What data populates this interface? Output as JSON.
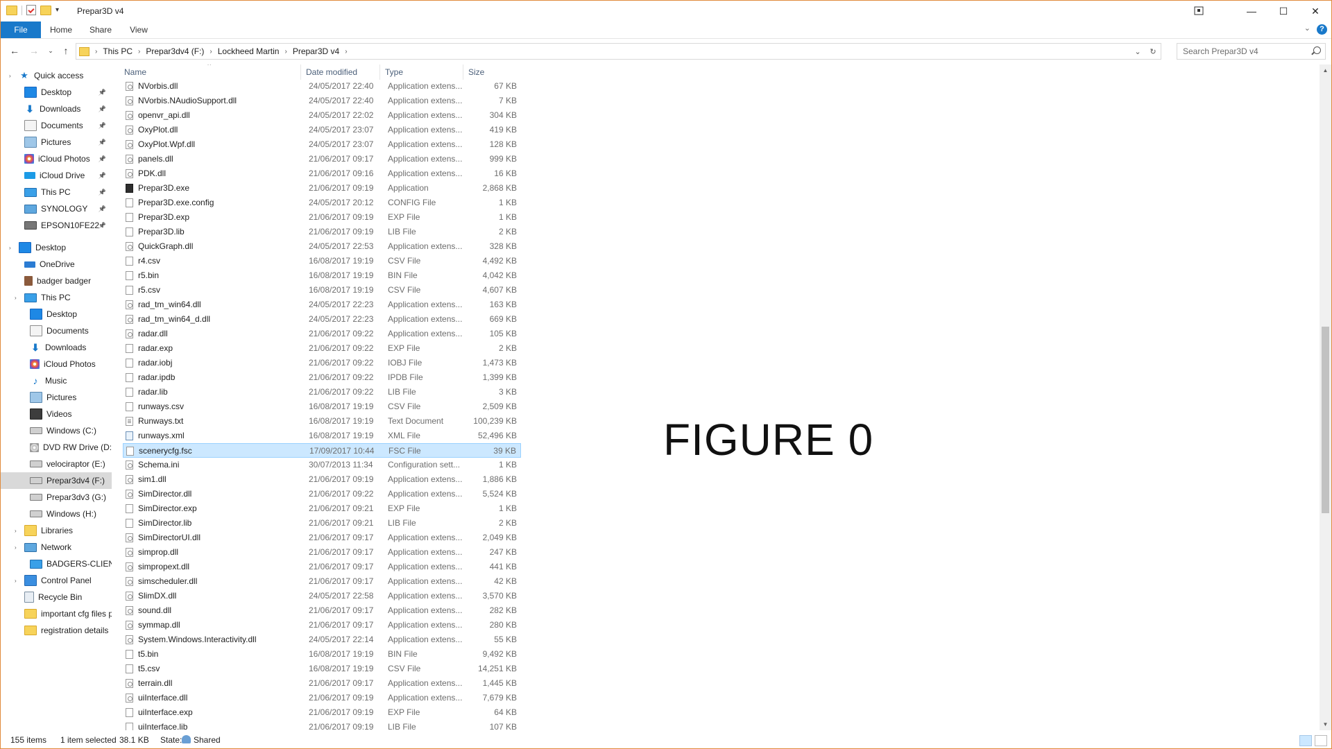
{
  "window": {
    "title": "Prepar3D v4",
    "controls": {
      "minimize": "—",
      "maximize": "☐",
      "close": "✕"
    }
  },
  "ribbon": {
    "tabs": [
      "File",
      "Home",
      "Share",
      "View"
    ]
  },
  "address": {
    "crumbs": [
      "This PC",
      "Prepar3dv4 (F:)",
      "Lockheed Martin",
      "Prepar3D v4"
    ]
  },
  "search": {
    "placeholder": "Search Prepar3D v4"
  },
  "nav": {
    "items": [
      {
        "label": "Quick access",
        "icon": "star-icon",
        "pinned": false,
        "selected": false
      },
      {
        "label": "Desktop",
        "icon": "desktop-icon",
        "pinned": true,
        "selected": false
      },
      {
        "label": "Downloads",
        "icon": "download-icon",
        "pinned": true,
        "selected": false
      },
      {
        "label": "Documents",
        "icon": "documents-icon",
        "pinned": true,
        "selected": false
      },
      {
        "label": "Pictures",
        "icon": "pictures-icon",
        "pinned": true,
        "selected": false
      },
      {
        "label": "iCloud Photos",
        "icon": "icloud-photos-icon",
        "pinned": true,
        "selected": false
      },
      {
        "label": "iCloud Drive",
        "icon": "icloud-drive-icon",
        "pinned": true,
        "selected": false
      },
      {
        "label": "This PC",
        "icon": "computer-icon",
        "pinned": true,
        "selected": false
      },
      {
        "label": "SYNOLOGY",
        "icon": "network-drive-icon",
        "pinned": true,
        "selected": false
      },
      {
        "label": "EPSON10FE22",
        "icon": "printer-icon",
        "pinned": true,
        "selected": false
      },
      {
        "label": "Desktop",
        "icon": "desktop-icon",
        "pinned": false,
        "selected": false
      },
      {
        "label": "OneDrive",
        "icon": "onedrive-icon",
        "pinned": false,
        "selected": false
      },
      {
        "label": "badger badger",
        "icon": "user-icon",
        "pinned": false,
        "selected": false
      },
      {
        "label": "This PC",
        "icon": "computer-icon",
        "pinned": false,
        "selected": false
      },
      {
        "label": "Desktop",
        "icon": "desktop-icon",
        "pinned": false,
        "selected": false
      },
      {
        "label": "Documents",
        "icon": "documents-icon",
        "pinned": false,
        "selected": false
      },
      {
        "label": "Downloads",
        "icon": "download-icon",
        "pinned": false,
        "selected": false
      },
      {
        "label": "iCloud Photos",
        "icon": "icloud-photos-icon",
        "pinned": false,
        "selected": false
      },
      {
        "label": "Music",
        "icon": "music-icon",
        "pinned": false,
        "selected": false
      },
      {
        "label": "Pictures",
        "icon": "pictures-icon",
        "pinned": false,
        "selected": false
      },
      {
        "label": "Videos",
        "icon": "videos-icon",
        "pinned": false,
        "selected": false
      },
      {
        "label": "Windows (C:)",
        "icon": "drive-icon",
        "pinned": false,
        "selected": false
      },
      {
        "label": "DVD RW Drive (D:)",
        "icon": "dvd-icon",
        "pinned": false,
        "selected": false
      },
      {
        "label": "velociraptor (E:)",
        "icon": "drive-icon",
        "pinned": false,
        "selected": false
      },
      {
        "label": "Prepar3dv4 (F:)",
        "icon": "drive-icon",
        "pinned": false,
        "selected": true
      },
      {
        "label": "Prepar3dv3 (G:)",
        "icon": "drive-icon",
        "pinned": false,
        "selected": false
      },
      {
        "label": "Windows (H:)",
        "icon": "drive-icon",
        "pinned": false,
        "selected": false
      },
      {
        "label": "Libraries",
        "icon": "libraries-icon",
        "pinned": false,
        "selected": false
      },
      {
        "label": "Network",
        "icon": "network-icon",
        "pinned": false,
        "selected": false
      },
      {
        "label": "BADGERS-CLIENT",
        "icon": "computer-icon",
        "pinned": false,
        "selected": false
      },
      {
        "label": "Control Panel",
        "icon": "control-panel-icon",
        "pinned": false,
        "selected": false
      },
      {
        "label": "Recycle Bin",
        "icon": "recycle-bin-icon",
        "pinned": false,
        "selected": false
      },
      {
        "label": "important cfg files p",
        "icon": "folder-icon",
        "pinned": false,
        "selected": false
      },
      {
        "label": "registration details",
        "icon": "folder-icon",
        "pinned": false,
        "selected": false
      }
    ]
  },
  "columns": {
    "name": "Name",
    "date": "Date modified",
    "type": "Type",
    "size": "Size"
  },
  "files": [
    {
      "name": "NVorbis.dll",
      "date": "24/05/2017 22:40",
      "type": "Application extens...",
      "size": "67 KB",
      "icon": "dll",
      "selected": false
    },
    {
      "name": "NVorbis.NAudioSupport.dll",
      "date": "24/05/2017 22:40",
      "type": "Application extens...",
      "size": "7 KB",
      "icon": "dll",
      "selected": false
    },
    {
      "name": "openvr_api.dll",
      "date": "24/05/2017 22:02",
      "type": "Application extens...",
      "size": "304 KB",
      "icon": "dll",
      "selected": false
    },
    {
      "name": "OxyPlot.dll",
      "date": "24/05/2017 23:07",
      "type": "Application extens...",
      "size": "419 KB",
      "icon": "dll",
      "selected": false
    },
    {
      "name": "OxyPlot.Wpf.dll",
      "date": "24/05/2017 23:07",
      "type": "Application extens...",
      "size": "128 KB",
      "icon": "dll",
      "selected": false
    },
    {
      "name": "panels.dll",
      "date": "21/06/2017 09:17",
      "type": "Application extens...",
      "size": "999 KB",
      "icon": "dll",
      "selected": false
    },
    {
      "name": "PDK.dll",
      "date": "21/06/2017 09:16",
      "type": "Application extens...",
      "size": "16 KB",
      "icon": "dll",
      "selected": false
    },
    {
      "name": "Prepar3D.exe",
      "date": "21/06/2017 09:19",
      "type": "Application",
      "size": "2,868 KB",
      "icon": "exe",
      "selected": false
    },
    {
      "name": "Prepar3D.exe.config",
      "date": "24/05/2017 20:12",
      "type": "CONFIG File",
      "size": "1 KB",
      "icon": "file",
      "selected": false
    },
    {
      "name": "Prepar3D.exp",
      "date": "21/06/2017 09:19",
      "type": "EXP File",
      "size": "1 KB",
      "icon": "file",
      "selected": false
    },
    {
      "name": "Prepar3D.lib",
      "date": "21/06/2017 09:19",
      "type": "LIB File",
      "size": "2 KB",
      "icon": "file",
      "selected": false
    },
    {
      "name": "QuickGraph.dll",
      "date": "24/05/2017 22:53",
      "type": "Application extens...",
      "size": "328 KB",
      "icon": "dll",
      "selected": false
    },
    {
      "name": "r4.csv",
      "date": "16/08/2017 19:19",
      "type": "CSV File",
      "size": "4,492 KB",
      "icon": "file",
      "selected": false
    },
    {
      "name": "r5.bin",
      "date": "16/08/2017 19:19",
      "type": "BIN File",
      "size": "4,042 KB",
      "icon": "file",
      "selected": false
    },
    {
      "name": "r5.csv",
      "date": "16/08/2017 19:19",
      "type": "CSV File",
      "size": "4,607 KB",
      "icon": "file",
      "selected": false
    },
    {
      "name": "rad_tm_win64.dll",
      "date": "24/05/2017 22:23",
      "type": "Application extens...",
      "size": "163 KB",
      "icon": "dll",
      "selected": false
    },
    {
      "name": "rad_tm_win64_d.dll",
      "date": "24/05/2017 22:23",
      "type": "Application extens...",
      "size": "669 KB",
      "icon": "dll",
      "selected": false
    },
    {
      "name": "radar.dll",
      "date": "21/06/2017 09:22",
      "type": "Application extens...",
      "size": "105 KB",
      "icon": "dll",
      "selected": false
    },
    {
      "name": "radar.exp",
      "date": "21/06/2017 09:22",
      "type": "EXP File",
      "size": "2 KB",
      "icon": "file",
      "selected": false
    },
    {
      "name": "radar.iobj",
      "date": "21/06/2017 09:22",
      "type": "IOBJ File",
      "size": "1,473 KB",
      "icon": "file",
      "selected": false
    },
    {
      "name": "radar.ipdb",
      "date": "21/06/2017 09:22",
      "type": "IPDB File",
      "size": "1,399 KB",
      "icon": "file",
      "selected": false
    },
    {
      "name": "radar.lib",
      "date": "21/06/2017 09:22",
      "type": "LIB File",
      "size": "3 KB",
      "icon": "file",
      "selected": false
    },
    {
      "name": "runways.csv",
      "date": "16/08/2017 19:19",
      "type": "CSV File",
      "size": "2,509 KB",
      "icon": "file",
      "selected": false
    },
    {
      "name": "Runways.txt",
      "date": "16/08/2017 19:19",
      "type": "Text Document",
      "size": "100,239 KB",
      "icon": "txt",
      "selected": false
    },
    {
      "name": "runways.xml",
      "date": "16/08/2017 19:19",
      "type": "XML File",
      "size": "52,496 KB",
      "icon": "xml",
      "selected": false
    },
    {
      "name": "scenerycfg.fsc",
      "date": "17/09/2017 10:44",
      "type": "FSC File",
      "size": "39 KB",
      "icon": "file",
      "selected": true
    },
    {
      "name": "Schema.ini",
      "date": "30/07/2013 11:34",
      "type": "Configuration sett...",
      "size": "1 KB",
      "icon": "dll",
      "selected": false
    },
    {
      "name": "sim1.dll",
      "date": "21/06/2017 09:19",
      "type": "Application extens...",
      "size": "1,886 KB",
      "icon": "dll",
      "selected": false
    },
    {
      "name": "SimDirector.dll",
      "date": "21/06/2017 09:22",
      "type": "Application extens...",
      "size": "5,524 KB",
      "icon": "dll",
      "selected": false
    },
    {
      "name": "SimDirector.exp",
      "date": "21/06/2017 09:21",
      "type": "EXP File",
      "size": "1 KB",
      "icon": "file",
      "selected": false
    },
    {
      "name": "SimDirector.lib",
      "date": "21/06/2017 09:21",
      "type": "LIB File",
      "size": "2 KB",
      "icon": "file",
      "selected": false
    },
    {
      "name": "SimDirectorUI.dll",
      "date": "21/06/2017 09:17",
      "type": "Application extens...",
      "size": "2,049 KB",
      "icon": "dll",
      "selected": false
    },
    {
      "name": "simprop.dll",
      "date": "21/06/2017 09:17",
      "type": "Application extens...",
      "size": "247 KB",
      "icon": "dll",
      "selected": false
    },
    {
      "name": "simpropext.dll",
      "date": "21/06/2017 09:17",
      "type": "Application extens...",
      "size": "441 KB",
      "icon": "dll",
      "selected": false
    },
    {
      "name": "simscheduler.dll",
      "date": "21/06/2017 09:17",
      "type": "Application extens...",
      "size": "42 KB",
      "icon": "dll",
      "selected": false
    },
    {
      "name": "SlimDX.dll",
      "date": "24/05/2017 22:58",
      "type": "Application extens...",
      "size": "3,570 KB",
      "icon": "dll",
      "selected": false
    },
    {
      "name": "sound.dll",
      "date": "21/06/2017 09:17",
      "type": "Application extens...",
      "size": "282 KB",
      "icon": "dll",
      "selected": false
    },
    {
      "name": "symmap.dll",
      "date": "21/06/2017 09:17",
      "type": "Application extens...",
      "size": "280 KB",
      "icon": "dll",
      "selected": false
    },
    {
      "name": "System.Windows.Interactivity.dll",
      "date": "24/05/2017 22:14",
      "type": "Application extens...",
      "size": "55 KB",
      "icon": "dll",
      "selected": false
    },
    {
      "name": "t5.bin",
      "date": "16/08/2017 19:19",
      "type": "BIN File",
      "size": "9,492 KB",
      "icon": "file",
      "selected": false
    },
    {
      "name": "t5.csv",
      "date": "16/08/2017 19:19",
      "type": "CSV File",
      "size": "14,251 KB",
      "icon": "file",
      "selected": false
    },
    {
      "name": "terrain.dll",
      "date": "21/06/2017 09:17",
      "type": "Application extens...",
      "size": "1,445 KB",
      "icon": "dll",
      "selected": false
    },
    {
      "name": "uiInterface.dll",
      "date": "21/06/2017 09:19",
      "type": "Application extens...",
      "size": "7,679 KB",
      "icon": "dll",
      "selected": false
    },
    {
      "name": "uiInterface.exp",
      "date": "21/06/2017 09:19",
      "type": "EXP File",
      "size": "64 KB",
      "icon": "file",
      "selected": false
    },
    {
      "name": "uiInterface.lib",
      "date": "21/06/2017 09:19",
      "type": "LIB File",
      "size": "107 KB",
      "icon": "file",
      "selected": false
    }
  ],
  "overlay": {
    "text": "FIGURE 0"
  },
  "status": {
    "count": "155 items",
    "selection": "1 item selected",
    "size": "38.1 KB",
    "state_label": "State:",
    "state_value": "Shared"
  },
  "scroll": {
    "position": 0.55,
    "visible_fraction": 0.29
  },
  "colors": {
    "accent": "#1979ca",
    "selection": "#cce8ff",
    "selection_border": "#99d1ff",
    "window_border": "#e08a3c"
  }
}
